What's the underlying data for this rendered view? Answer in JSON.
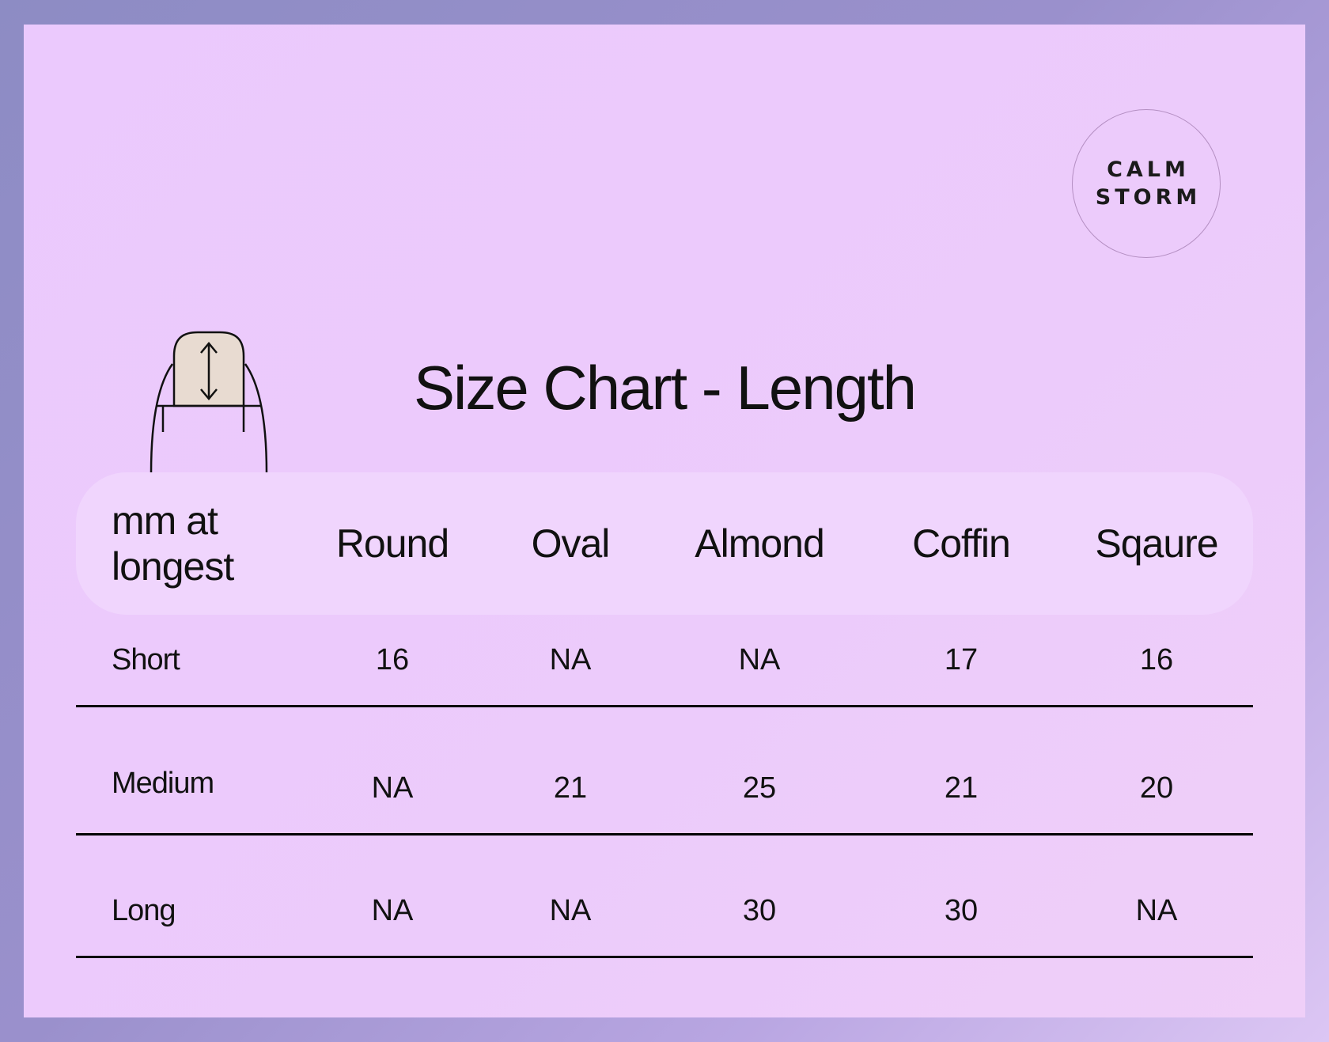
{
  "title": "Size Chart - Length",
  "brand": {
    "line1": "CALM",
    "line2": "STORM"
  },
  "icon": "nail-length-icon",
  "table": {
    "corner_label": "mm at longest",
    "columns": [
      "Round",
      "Oval",
      "Almond",
      "Coffin",
      "Sqaure"
    ],
    "rows": [
      {
        "label": "Short",
        "values": [
          "16",
          "NA",
          "NA",
          "17",
          "16"
        ]
      },
      {
        "label": "Medium",
        "values": [
          "NA",
          "21",
          "25",
          "21",
          "20"
        ]
      },
      {
        "label": "Long",
        "values": [
          "NA",
          "NA",
          "30",
          "30",
          "NA"
        ]
      }
    ]
  },
  "colors": {
    "frame": "#8d8cc4",
    "background": "#ebc9fd",
    "header_band": "#f0d5fd",
    "nail_fill": "#e8dbd1",
    "text": "#111111"
  }
}
